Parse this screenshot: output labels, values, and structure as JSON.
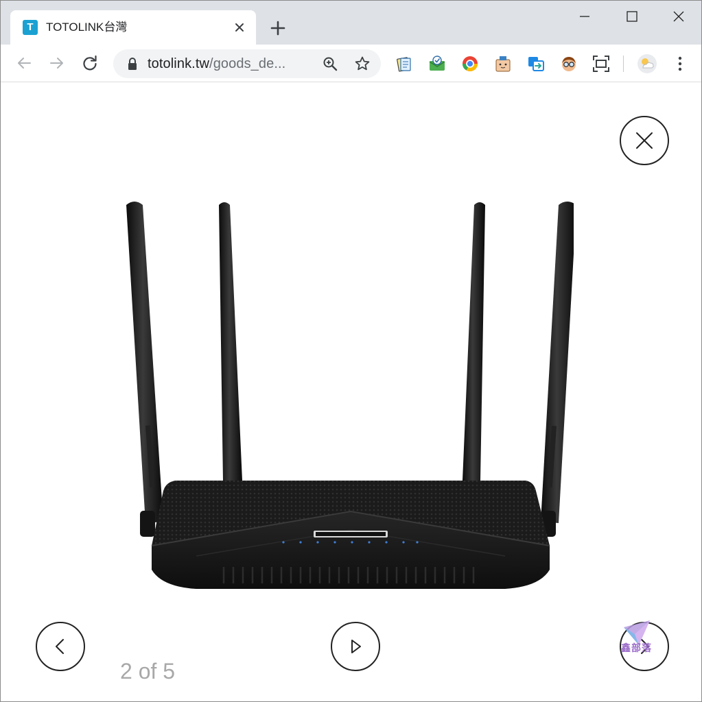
{
  "browser": {
    "tab": {
      "favicon_letter": "T",
      "title": "TOTOLINK台灣"
    },
    "address": {
      "host": "totolink.tw",
      "path": "/goods_de..."
    },
    "icons": {
      "tab_close": "close-icon",
      "new_tab": "plus-icon",
      "minimize": "minimize-icon",
      "maximize": "maximize-icon",
      "close_window": "close-icon",
      "back": "arrow-left-icon",
      "forward": "arrow-right-icon",
      "reload": "reload-icon",
      "lock": "lock-icon",
      "zoom": "zoom-icon",
      "bookmark": "star-icon",
      "menu": "kebab-menu-icon"
    },
    "extensions": [
      "notes-extension-icon",
      "mail-check-extension-icon",
      "chrome-store-extension-icon",
      "box-face-extension-icon",
      "share-extension-icon",
      "avatar-glasses-extension-icon",
      "screenshot-extension-icon",
      "weather-extension-icon"
    ]
  },
  "lightbox": {
    "counter": "2 of 5",
    "watermark_text": "鑫部落",
    "buttons": {
      "close": "close-icon",
      "previous": "chevron-left-icon",
      "play": "play-icon",
      "next": "chevron-right-icon"
    }
  },
  "colors": {
    "tabstrip": "#dee1e6",
    "omnibox": "#f1f3f4",
    "favicon": "#1aa1d2",
    "counter_text": "#a8a8a8"
  }
}
